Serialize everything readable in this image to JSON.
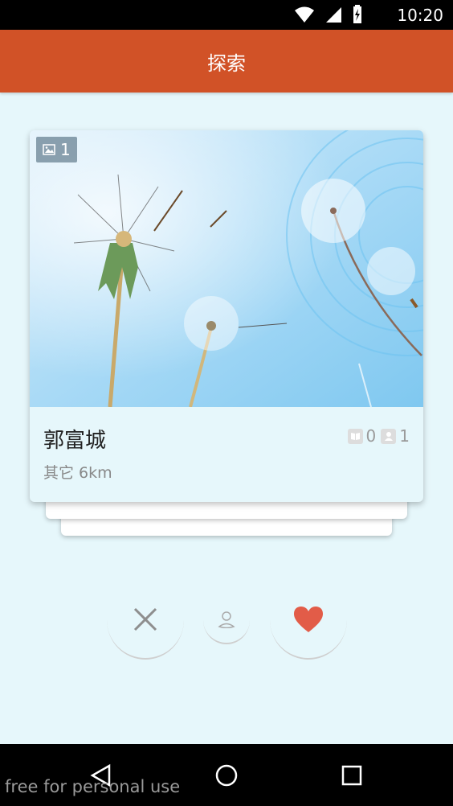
{
  "status_bar": {
    "time": "10:20"
  },
  "app_bar": {
    "title": "探索"
  },
  "card": {
    "photo_count": "1",
    "name": "郭富城",
    "meta": "其它 6km",
    "likes_count": "0",
    "friends_count": "1"
  },
  "actions": [
    {
      "name": "dislike-button",
      "icon": "close-icon"
    },
    {
      "name": "profile-button",
      "icon": "person-icon"
    },
    {
      "name": "like-button",
      "icon": "heart-icon"
    }
  ],
  "colors": {
    "accent": "#d15227",
    "heart": "#e25c48",
    "background": "#e6f7fb"
  },
  "watermark": "free for personal use"
}
